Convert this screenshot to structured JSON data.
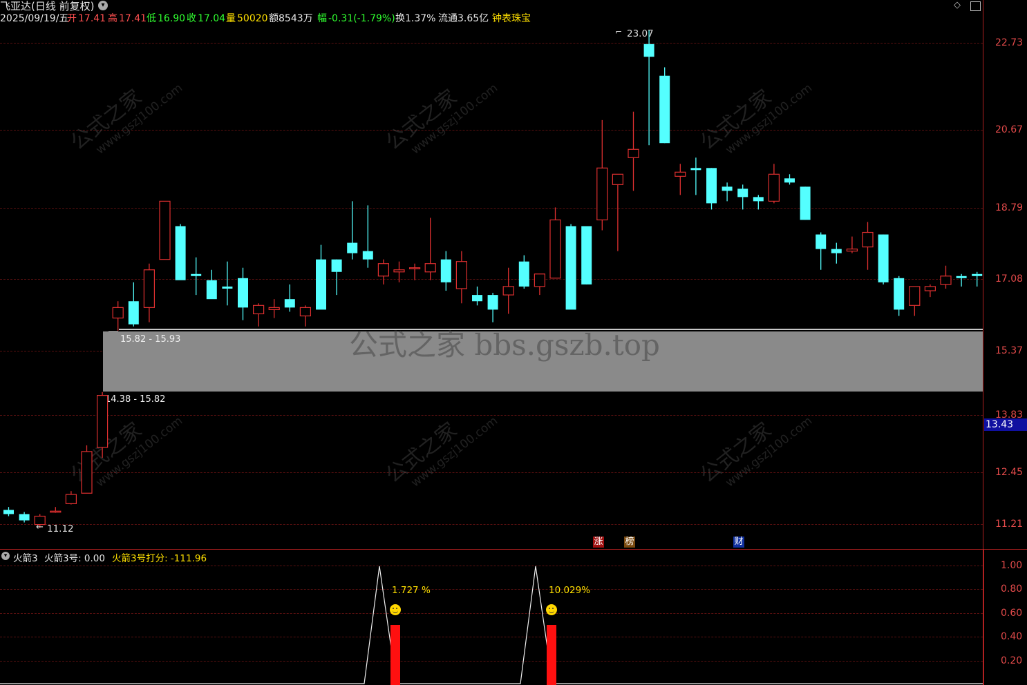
{
  "header": {
    "title": "飞亚达(日线 前复权)",
    "date": "2025/09/19/五",
    "open_label": "开",
    "open_value": "17.41",
    "high_label": "高",
    "high_value": "17.41",
    "low_label": "低",
    "low_value": "16.90",
    "close_label": "收",
    "close_value": "17.04",
    "volume_label": "量",
    "volume_value": "50020",
    "amount": "额8543万",
    "change_label": "幅",
    "change_value": "-0.31(-1.79%)",
    "turnover": "换1.37%",
    "float_cap": "流通3.65亿",
    "sector": "钟表珠宝"
  },
  "main_axis": {
    "labels": [
      "22.73",
      "20.67",
      "18.79",
      "17.08",
      "15.37",
      "13.83",
      "12.45",
      "11.21"
    ],
    "current_price": "13.43"
  },
  "annotations": {
    "peak": "23.07",
    "trough": "11.12",
    "band_top": "15.82 - 15.93",
    "band_bottom": "14.38 - 15.82"
  },
  "watermarks": {
    "band_text": "公式之家 bbs.gszb.top",
    "diag_main": "公式之家",
    "diag_sub": "www.gszj100.com"
  },
  "event_tags": [
    "涨",
    "榜",
    "财"
  ],
  "sub_chart": {
    "name": "火箭3",
    "line1_label": "火箭3号: 0.00",
    "line2_label": "火箭3号打分: -111.96",
    "axis_labels": [
      "1.00",
      "0.80",
      "0.60",
      "0.40",
      "0.20"
    ],
    "signals": [
      {
        "pct": "1.727 %"
      },
      {
        "pct": "10.029%"
      }
    ]
  },
  "colors": {
    "up": "#e03030",
    "down": "#54ffff",
    "axis": "#e24a4a",
    "grid": "#5a1010",
    "yellow": "#ffe000"
  },
  "chart_data": {
    "type": "candlestick",
    "series_name": "飞亚达",
    "ohlc": [
      [
        11.55,
        11.62,
        11.4,
        11.45
      ],
      [
        11.45,
        11.5,
        11.25,
        11.3
      ],
      [
        11.2,
        11.45,
        11.12,
        11.4
      ],
      [
        11.5,
        11.62,
        11.48,
        11.52
      ],
      [
        11.7,
        12.0,
        11.68,
        11.92
      ],
      [
        11.95,
        13.1,
        11.95,
        12.95
      ],
      [
        13.05,
        14.38,
        12.8,
        14.3
      ],
      [
        16.15,
        16.55,
        15.85,
        16.4
      ],
      [
        16.55,
        17.0,
        15.95,
        16.0
      ],
      [
        16.4,
        17.45,
        16.05,
        17.3
      ],
      [
        17.55,
        18.45,
        17.55,
        18.95
      ],
      [
        18.35,
        18.4,
        17.28,
        17.05
      ],
      [
        17.2,
        17.6,
        16.7,
        17.15
      ],
      [
        17.05,
        17.3,
        16.9,
        16.6
      ],
      [
        16.9,
        17.5,
        16.45,
        16.85
      ],
      [
        17.1,
        17.35,
        16.1,
        16.4
      ],
      [
        16.25,
        16.5,
        15.95,
        16.45
      ],
      [
        16.35,
        16.6,
        16.15,
        16.4
      ],
      [
        16.6,
        16.95,
        16.3,
        16.4
      ],
      [
        16.2,
        16.45,
        15.95,
        16.4
      ],
      [
        17.55,
        17.9,
        16.45,
        16.35
      ],
      [
        17.55,
        17.55,
        16.7,
        17.25
      ],
      [
        17.95,
        18.95,
        17.55,
        17.7
      ],
      [
        17.75,
        18.85,
        17.35,
        17.55
      ],
      [
        17.15,
        17.55,
        16.95,
        17.45
      ],
      [
        17.25,
        17.5,
        17.0,
        17.3
      ],
      [
        17.35,
        17.45,
        17.05,
        17.35
      ],
      [
        17.25,
        18.55,
        17.05,
        17.45
      ],
      [
        17.55,
        17.75,
        16.8,
        17.0
      ],
      [
        16.85,
        17.75,
        16.5,
        17.5
      ],
      [
        16.7,
        16.9,
        16.45,
        16.55
      ],
      [
        16.7,
        16.75,
        16.05,
        16.35
      ],
      [
        16.7,
        17.35,
        16.25,
        16.9
      ],
      [
        17.5,
        17.65,
        16.85,
        16.9
      ],
      [
        16.9,
        17.2,
        16.7,
        17.2
      ],
      [
        17.1,
        18.8,
        17.1,
        18.5
      ],
      [
        18.35,
        18.4,
        16.7,
        16.35
      ],
      [
        18.35,
        18.3,
        16.95,
        16.95
      ],
      [
        18.5,
        20.9,
        18.25,
        19.75
      ],
      [
        19.35,
        19.6,
        17.75,
        19.6
      ],
      [
        20.0,
        21.1,
        19.2,
        20.2
      ],
      [
        22.7,
        23.07,
        20.3,
        22.4
      ],
      [
        21.95,
        22.15,
        20.35,
        20.35
      ],
      [
        19.55,
        19.85,
        19.1,
        19.65
      ],
      [
        19.75,
        20.0,
        19.1,
        19.7
      ],
      [
        19.75,
        19.75,
        18.75,
        18.9
      ],
      [
        19.3,
        19.4,
        18.95,
        19.2
      ],
      [
        19.25,
        19.35,
        18.75,
        19.05
      ],
      [
        19.05,
        19.1,
        18.75,
        18.95
      ],
      [
        18.95,
        19.85,
        18.9,
        19.6
      ],
      [
        19.5,
        19.6,
        19.35,
        19.4
      ],
      [
        19.3,
        19.3,
        18.5,
        18.5
      ],
      [
        18.15,
        18.2,
        17.3,
        17.8
      ],
      [
        17.8,
        17.95,
        17.45,
        17.7
      ],
      [
        17.75,
        18.1,
        17.7,
        17.8
      ],
      [
        17.85,
        18.45,
        17.3,
        18.2
      ],
      [
        18.15,
        18.15,
        16.95,
        17.0
      ],
      [
        17.1,
        17.15,
        16.2,
        16.35
      ],
      [
        16.45,
        16.9,
        16.2,
        16.9
      ],
      [
        16.8,
        16.95,
        16.65,
        16.9
      ],
      [
        16.95,
        17.4,
        16.85,
        17.15
      ],
      [
        17.15,
        17.2,
        16.9,
        17.1
      ],
      [
        17.2,
        17.25,
        16.9,
        17.15
      ],
      [
        17.1,
        17.2,
        16.95,
        17.12
      ],
      [
        17.05,
        17.15,
        16.9,
        17.04
      ]
    ],
    "y_axis_ticks": [
      22.73,
      20.67,
      18.79,
      17.08,
      15.37,
      13.83,
      12.45,
      11.21
    ],
    "sub_signals": [
      {
        "x_index": 23,
        "peak": 1.0,
        "bar": 0.5
      },
      {
        "x_index": 33,
        "peak": 1.0,
        "bar": 0.5
      }
    ]
  }
}
